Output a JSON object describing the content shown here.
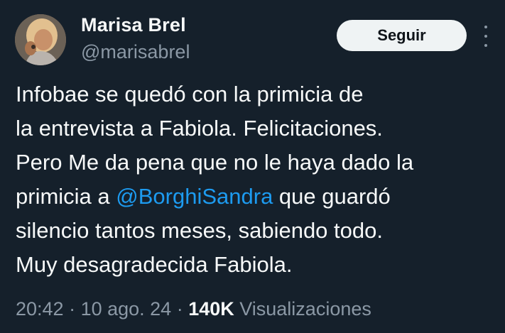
{
  "author": {
    "display_name": "Marisa Brel",
    "handle": "@marisabrel"
  },
  "follow_button": {
    "label": "Seguir"
  },
  "tweet": {
    "lines": [
      {
        "text": "Infobae se quedó con la primicia de"
      },
      {
        "text": "la entrevista a Fabiola. Felicitaciones."
      },
      {
        "text": "Pero Me da pena que no le haya dado la"
      },
      {
        "before": "primicia a ",
        "mention": "@BorghiSandra",
        "after": " que guardó"
      },
      {
        "text": "silencio tantos meses, sabiendo todo."
      },
      {
        "text": "Muy desagradecida Fabiola."
      }
    ]
  },
  "meta": {
    "time": "20:42",
    "sep1": " · ",
    "date": "10 ago. 24",
    "sep2": " · ",
    "views_count": "140K",
    "views_label": " Visualizaciones"
  },
  "colors": {
    "background": "#15202b",
    "text": "#f7f9f9",
    "secondary": "#8b98a5",
    "link": "#1d9bf0",
    "button_bg": "#eff3f4"
  },
  "icons": {
    "more": "more-vertical-icon"
  }
}
